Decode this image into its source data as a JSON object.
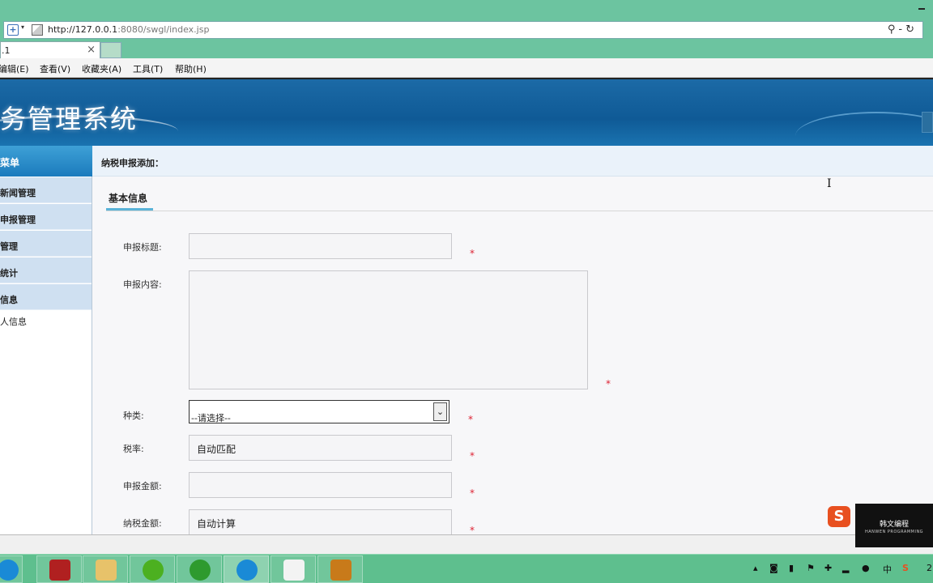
{
  "browser": {
    "url_host": "http://127.0.0.1",
    "url_rest": ":8080/swgl/index.jsp",
    "tab_title": ".1",
    "tab_close": "×",
    "menu": [
      "编辑(E)",
      "查看(V)",
      "收藏夹(A)",
      "工具(T)",
      "帮助(H)"
    ]
  },
  "header": {
    "title": "务管理系统"
  },
  "sidebar": {
    "heading": "菜单",
    "items": [
      {
        "label": "新闻管理"
      },
      {
        "label": "申报管理"
      },
      {
        "label": "管理"
      },
      {
        "label": "统计"
      },
      {
        "label": "信息"
      }
    ],
    "plain_item": "人信息"
  },
  "main": {
    "breadcrumb": "纳税申报添加：",
    "tab": "基本信息",
    "form": {
      "title_label": "申报标题:",
      "content_label": "申报内容:",
      "type_label": "种类:",
      "type_selected": "--请选择--",
      "rate_label": "税率:",
      "rate_value": "自动匹配",
      "amount_label": "申报金额:",
      "tax_label": "纳税金额:",
      "tax_value": "自动计算",
      "required_mark": "*"
    }
  },
  "overlay": {
    "sogou": "S",
    "logo_line1": "韩文编程",
    "logo_line2": "HANWEN PROGRAMMING"
  },
  "taskbar": {
    "tray_ime": "中",
    "tray_clock": "2"
  },
  "colors": {
    "chrome_green": "#6cc4a0",
    "header_blue": "#0f5a96",
    "required_red": "#d22233",
    "tab_accent": "#5ab3d8"
  }
}
